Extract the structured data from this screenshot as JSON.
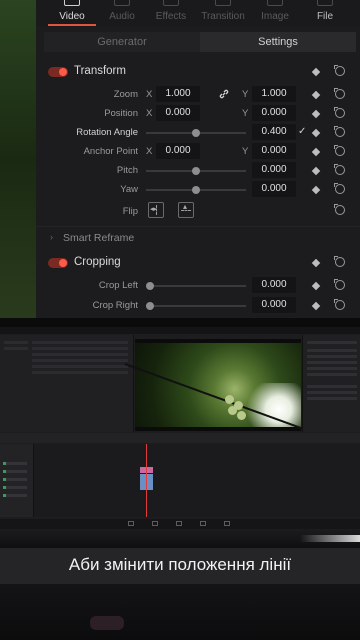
{
  "inspector_tabs": [
    {
      "label": "Video",
      "active": true
    },
    {
      "label": "Audio",
      "active": false
    },
    {
      "label": "Effects",
      "active": false
    },
    {
      "label": "Transition",
      "active": false
    },
    {
      "label": "Image",
      "active": false
    },
    {
      "label": "File",
      "active": false
    }
  ],
  "subtabs": {
    "generator": "Generator",
    "settings": "Settings"
  },
  "transform": {
    "title": "Transform",
    "zoom": {
      "label": "Zoom",
      "x_axis": "X",
      "x": "1.000",
      "y_axis": "Y",
      "y": "1.000"
    },
    "position": {
      "label": "Position",
      "x_axis": "X",
      "x": "0.000",
      "y_axis": "Y",
      "y": "0.000"
    },
    "rotation": {
      "label": "Rotation Angle",
      "value": "0.400"
    },
    "anchor": {
      "label": "Anchor Point",
      "x_axis": "X",
      "x": "0.000",
      "y_axis": "Y",
      "y": "0.000"
    },
    "pitch": {
      "label": "Pitch",
      "value": "0.000"
    },
    "yaw": {
      "label": "Yaw",
      "value": "0.000"
    },
    "flip": {
      "label": "Flip"
    }
  },
  "smart_reframe": {
    "title": "Smart Reframe"
  },
  "cropping": {
    "title": "Cropping",
    "crop_left": {
      "label": "Crop Left",
      "value": "0.000"
    },
    "crop_right": {
      "label": "Crop Right",
      "value": "0.000"
    }
  },
  "subtitle": "Аби змінити положення лінії",
  "colors": {
    "accent": "#e0553f",
    "toggle_on": "#ff5a47",
    "panel": "#1c1c1e"
  }
}
